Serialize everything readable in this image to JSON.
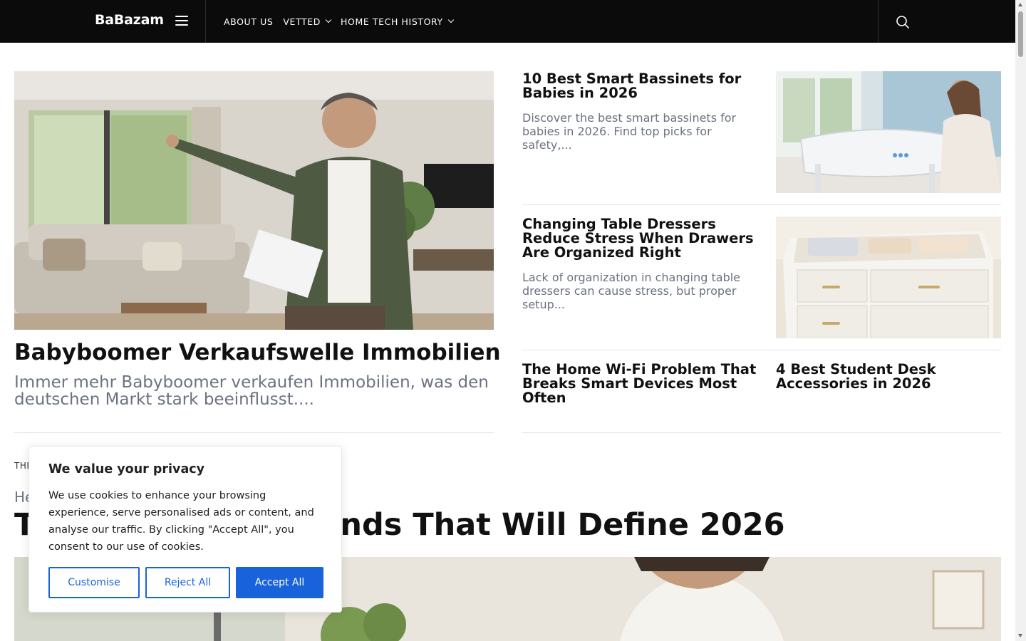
{
  "header": {
    "logo": "BaBazam",
    "nav": [
      {
        "label": "ABOUT US"
      },
      {
        "label": "VETTED"
      },
      {
        "label": "HOME TECH HISTORY"
      }
    ]
  },
  "hero": {
    "title": "Babyboomer Verkaufswelle Immobilien",
    "excerpt": "Immer mehr Babyboomer verkaufen Immobilien, was den deutschen Markt stark beeinflusst...."
  },
  "side_articles": [
    {
      "title": "10 Best Smart Bassinets for Babies in 2026",
      "excerpt": "Discover the best smart bassinets for babies in 2026. Find top picks for safety,..."
    },
    {
      "title": "Changing Table Dressers Reduce Stress When Drawers Are Organized Right",
      "excerpt": "Lack of organization in changing table dressers can cause stress, but proper setup..."
    },
    {
      "title": "The Home Wi-Fi Problem That Breaks Smart Devices Most Often"
    },
    {
      "title": "4 Best Student Desk Accessories in 2026"
    }
  ],
  "section": {
    "label": "THE",
    "subtitle": "He",
    "title": "The Home Tech Trends That Will Define 2026"
  },
  "cookie": {
    "title": "We value your privacy",
    "text": "We use cookies to enhance your browsing experience, serve personalised ads or content, and analyse our traffic. By clicking \"Accept All\", you consent to our use of cookies.",
    "customise": "Customise",
    "reject": "Reject All",
    "accept": "Accept All"
  },
  "colors": {
    "header_bg": "#0b0b0b",
    "accent": "#1863dc",
    "excerpt_gray": "#6b7280"
  }
}
